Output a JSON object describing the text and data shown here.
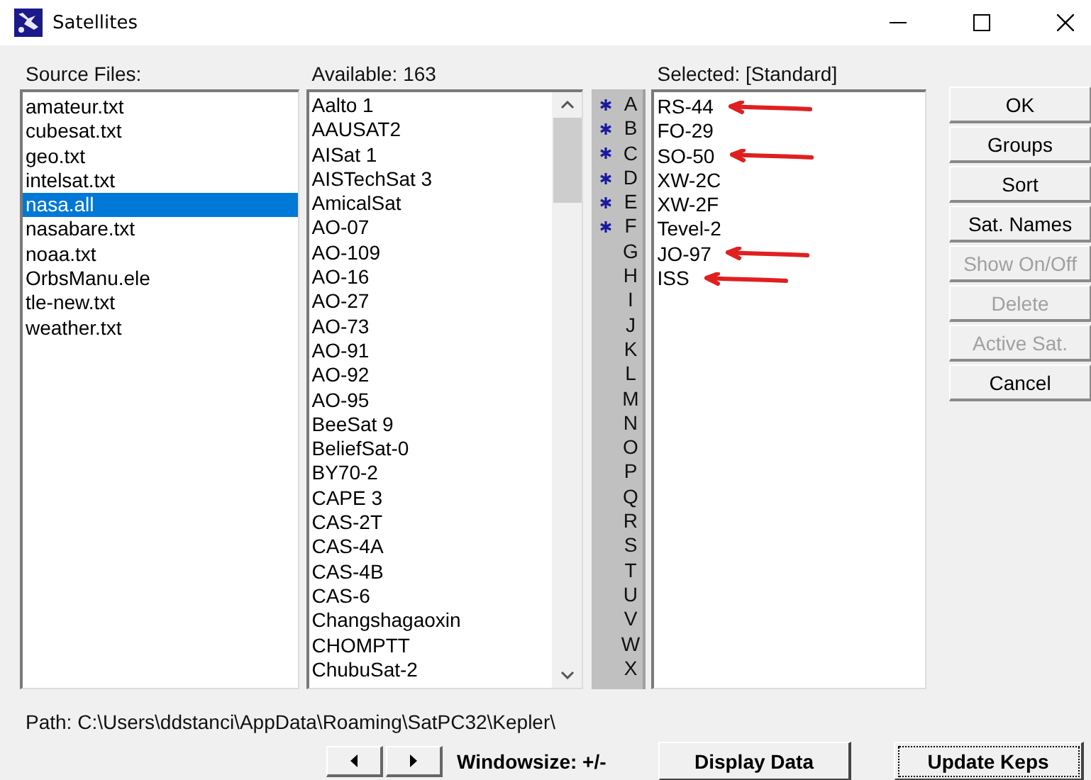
{
  "window": {
    "title": "Satellites"
  },
  "source_files": {
    "label": "Source Files:",
    "items": [
      {
        "name": "amateur.txt",
        "selected": false
      },
      {
        "name": "cubesat.txt",
        "selected": false
      },
      {
        "name": "geo.txt",
        "selected": false
      },
      {
        "name": "intelsat.txt",
        "selected": false
      },
      {
        "name": "nasa.all",
        "selected": true
      },
      {
        "name": "nasabare.txt",
        "selected": false
      },
      {
        "name": "noaa.txt",
        "selected": false
      },
      {
        "name": "OrbsManu.ele",
        "selected": false
      },
      {
        "name": "tle-new.txt",
        "selected": false
      },
      {
        "name": "weather.txt",
        "selected": false
      }
    ]
  },
  "available": {
    "label": "Available:  163",
    "items": [
      "Aalto 1",
      "AAUSAT2",
      "AISat 1",
      "AISTechSat 3",
      "AmicalSat",
      "AO-07",
      "AO-109",
      "AO-16",
      "AO-27",
      "AO-73",
      "AO-91",
      "AO-92",
      "AO-95",
      "BeeSat 9",
      "BeliefSat-0",
      "BY70-2",
      "CAPE 3",
      "CAS-2T",
      "CAS-4A",
      "CAS-4B",
      "CAS-6",
      "Changshagaoxin",
      "CHOMPTT",
      "ChubuSat-2"
    ]
  },
  "groups": [
    {
      "letter": "A",
      "starred": true
    },
    {
      "letter": "B",
      "starred": true
    },
    {
      "letter": "C",
      "starred": true
    },
    {
      "letter": "D",
      "starred": true
    },
    {
      "letter": "E",
      "starred": true
    },
    {
      "letter": "F",
      "starred": true
    },
    {
      "letter": "G",
      "starred": false
    },
    {
      "letter": "H",
      "starred": false
    },
    {
      "letter": "I",
      "starred": false
    },
    {
      "letter": "J",
      "starred": false
    },
    {
      "letter": "K",
      "starred": false
    },
    {
      "letter": "L",
      "starred": false
    },
    {
      "letter": "M",
      "starred": false
    },
    {
      "letter": "N",
      "starred": false
    },
    {
      "letter": "O",
      "starred": false
    },
    {
      "letter": "P",
      "starred": false
    },
    {
      "letter": "Q",
      "starred": false
    },
    {
      "letter": "R",
      "starred": false
    },
    {
      "letter": "S",
      "starred": false
    },
    {
      "letter": "T",
      "starred": false
    },
    {
      "letter": "U",
      "starred": false
    },
    {
      "letter": "V",
      "starred": false
    },
    {
      "letter": "W",
      "starred": false
    },
    {
      "letter": "X",
      "starred": false
    }
  ],
  "selected": {
    "label": "Selected: [Standard]",
    "items": [
      {
        "name": "RS-44",
        "marked": true
      },
      {
        "name": "FO-29",
        "marked": false
      },
      {
        "name": "SO-50",
        "marked": true
      },
      {
        "name": "XW-2C",
        "marked": false
      },
      {
        "name": "XW-2F",
        "marked": false
      },
      {
        "name": "Tevel-2",
        "marked": false
      },
      {
        "name": "JO-97",
        "marked": true
      },
      {
        "name": "ISS",
        "marked": true
      }
    ]
  },
  "buttons": [
    {
      "label": "OK",
      "disabled": false
    },
    {
      "label": "Groups",
      "disabled": false
    },
    {
      "label": "Sort",
      "disabled": false
    },
    {
      "label": "Sat. Names",
      "disabled": false
    },
    {
      "label": "Show On/Off",
      "disabled": true
    },
    {
      "label": "Delete",
      "disabled": true
    },
    {
      "label": "Active Sat.",
      "disabled": true
    },
    {
      "label": "Cancel",
      "disabled": false
    }
  ],
  "path": "Path: C:\\Users\\ddstanci\\AppData\\Roaming\\SatPC32\\Kepler\\",
  "bottom": {
    "windowsize": "Windowsize: +/-",
    "display_button": "Display Data",
    "update_button": "Update Keps"
  }
}
